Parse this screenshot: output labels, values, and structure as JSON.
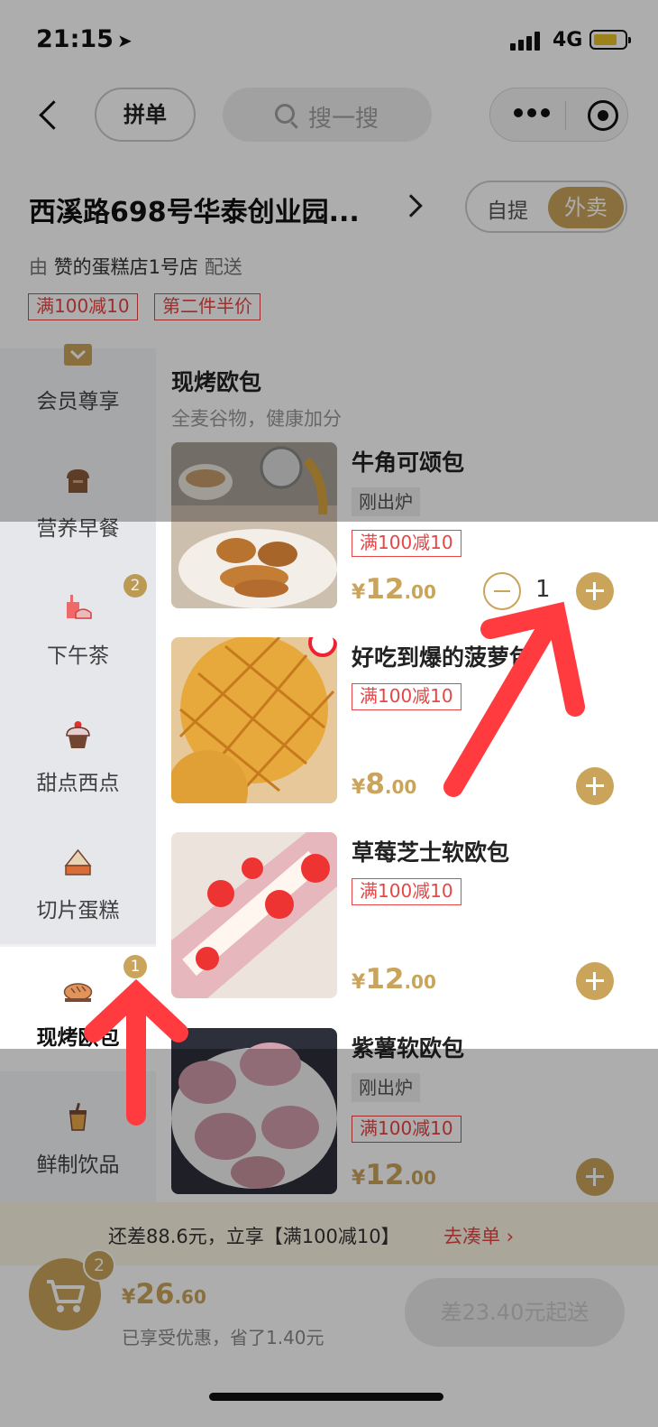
{
  "status_bar": {
    "time": "21:15",
    "location_glyph": "➤",
    "network": "4G"
  },
  "nav": {
    "group_order_label": "拼单",
    "search_placeholder": "搜一搜"
  },
  "header": {
    "address": "西溪路698号华泰创业园...",
    "mode_pickup": "自提",
    "mode_delivery": "外卖",
    "shop_prefix": "由",
    "shop_name": "赞的蛋糕店1号店",
    "shop_suffix": "配送",
    "promo_tags": [
      "满100减10",
      "第二件半价"
    ]
  },
  "sidebar": {
    "items": [
      {
        "label": "会员尊享",
        "icon": "member-gift-icon",
        "badge": ""
      },
      {
        "label": "营养早餐",
        "icon": "toast-bread-icon",
        "badge": ""
      },
      {
        "label": "下午茶",
        "icon": "afternoon-tea-icon",
        "badge": "2"
      },
      {
        "label": "甜点西点",
        "icon": "cupcake-icon",
        "badge": ""
      },
      {
        "label": "切片蛋糕",
        "icon": "cake-slice-icon",
        "badge": ""
      },
      {
        "label": "现烤欧包",
        "icon": "bread-loaf-icon",
        "badge": "1"
      },
      {
        "label": "鲜制饮品",
        "icon": "drink-cup-icon",
        "badge": ""
      }
    ]
  },
  "section": {
    "title": "现烤欧包",
    "subtitle": "全麦谷物，健康加分"
  },
  "products": [
    {
      "name": "牛角可颂包",
      "fresh": "刚出炉",
      "tag": "满100减10",
      "currency": "¥",
      "price_int": "12",
      "price_dec": ".00",
      "qty": "1"
    },
    {
      "name": "好吃到爆的菠萝包",
      "fresh": "",
      "tag": "满100减10",
      "currency": "¥",
      "price_int": "8",
      "price_dec": ".00",
      "qty": ""
    },
    {
      "name": "草莓芝士软欧包",
      "fresh": "",
      "tag": "满100减10",
      "currency": "¥",
      "price_int": "12",
      "price_dec": ".00",
      "qty": ""
    },
    {
      "name": "紫薯软欧包",
      "fresh": "刚出炉",
      "tag": "满100减10",
      "currency": "¥",
      "price_int": "12",
      "price_dec": ".00",
      "qty": ""
    }
  ],
  "promo_bar": {
    "text": "还差88.6元，立享【满100减10】",
    "link": "去凑单 ›"
  },
  "cart": {
    "badge": "2",
    "currency": "¥",
    "total_int": "26",
    "total_dec": ".60",
    "discount_note": "已享受优惠，省了1.40元",
    "checkout_label": "差23.40元起送"
  },
  "colors": {
    "accent": "#c9a45a",
    "promo_red": "#e84545",
    "annotation_arrow": "#ff3b40"
  }
}
